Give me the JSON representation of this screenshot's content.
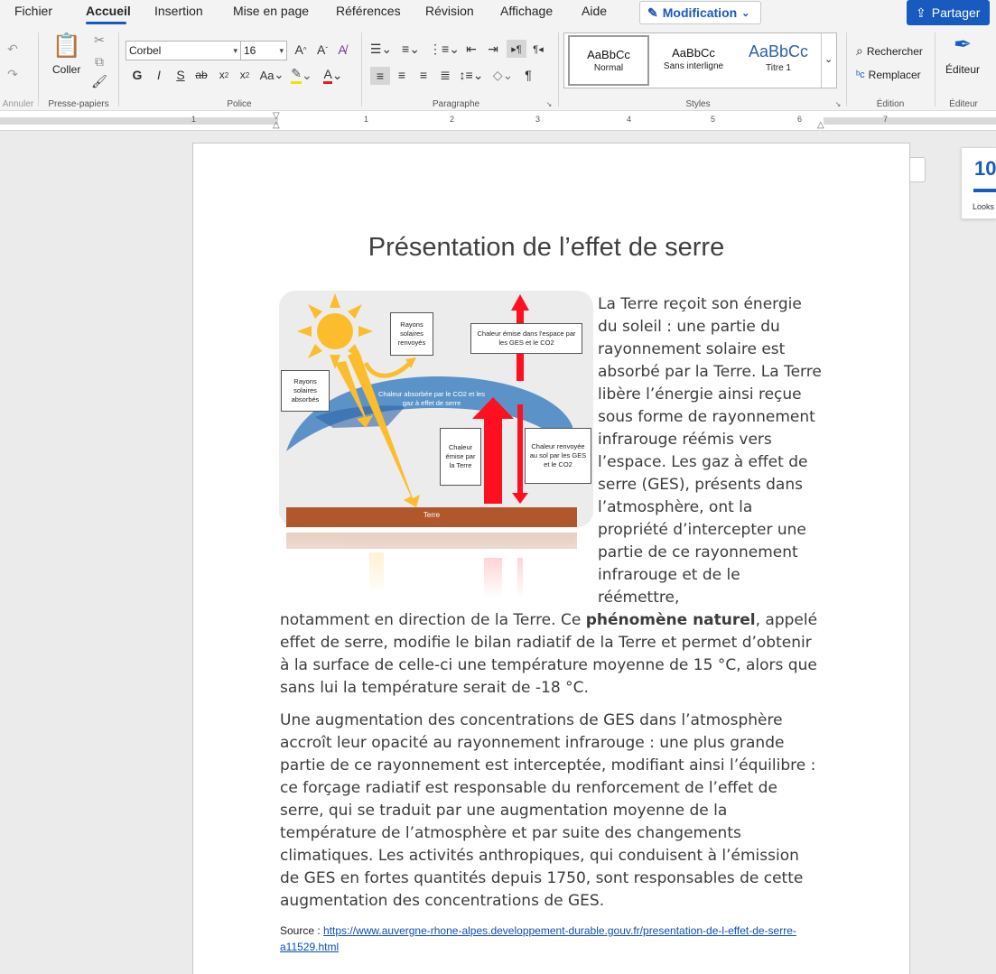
{
  "menu": {
    "items": [
      "Fichier",
      "Accueil",
      "Insertion",
      "Mise en page",
      "Références",
      "Révision",
      "Affichage",
      "Aide"
    ],
    "mode_label": "Modification",
    "share_label": "Partager"
  },
  "ribbon": {
    "undo_group": "Annuler",
    "clipboard": {
      "paste_label": "Coller",
      "group": "Presse-papiers"
    },
    "font": {
      "name": "Corbel",
      "size": "16",
      "group": "Police",
      "case_label": "Aa"
    },
    "paragraph": {
      "group": "Paragraphe"
    },
    "styles": {
      "group": "Styles",
      "items": [
        {
          "sample": "AaBbCc",
          "name": "Normal"
        },
        {
          "sample": "AaBbCc",
          "name": "Sans interligne"
        },
        {
          "sample": "AaBbCc",
          "name": "Titre 1"
        }
      ]
    },
    "edition": {
      "search": "Rechercher",
      "replace": "Remplacer",
      "group": "Édition"
    },
    "editor": {
      "label": "Éditeur",
      "group": "Éditeur"
    }
  },
  "ruler": {
    "numbers": [
      "1",
      "1",
      "2",
      "3",
      "4",
      "5",
      "6",
      "7"
    ]
  },
  "looks": {
    "count": "10",
    "label": "Looks"
  },
  "document": {
    "title": "Présentation de l’effet de serre",
    "p1_right": "La Terre reçoit son énergie du soleil : une partie du rayonnement solaire est absorbé par la Terre. La Terre libère l’énergie ainsi reçue sous forme de rayonnement infrarouge réémis vers l’espace. Les gaz à effet de serre (GES), présents dans l’atmosphère, ont la propriété d’intercepter une partie de ce rayonnement infrarouge et de le réémettre,",
    "p1_cont_before": "notamment en direction de la Terre. Ce ",
    "p1_bold": "phénomène naturel",
    "p1_cont_after": ", appelé effet de serre, modifie le bilan radiatif de la Terre et permet d’obtenir à la surface de celle-ci une température moyenne de 15 °C, alors que sans lui la température serait de -18 °C.",
    "p2": "Une augmentation des concentrations de GES dans l’atmosphère accroît leur opacité au rayonnement infrarouge : une plus grande partie de ce rayonnement est interceptée, modifiant ainsi l’équilibre : ce forçage radiatif est responsable du renforcement de l’effet de serre, qui se traduit par une augmentation moyenne de la température de l’atmosphère et par suite des changements climatiques. Les activités anthropiques, qui conduisent à l’émission de GES en fortes quantités depuis 1750, sont responsables de cette augmentation des concentrations de GES.",
    "source_label": "Source : ",
    "source_url": "https://www.auvergne-rhone-alpes.developpement-durable.gouv.fr/presentation-de-l-effet-de-serre-a11529.html"
  },
  "diagram": {
    "reflected_solar": "Rayons solaires renvoyés",
    "absorbed_solar": "Rayons solaires absorbés",
    "heat_space": "Chaleur émise dans l'espace par les GES et le CO2",
    "heat_absorbed": "Chaleur absorbée par le CO2 et les gaz à effet de serre",
    "heat_earth": "Chaleur émise par la Terre",
    "heat_returned": "Chaleur renvoyée au sol par les GES et le CO2",
    "ground": "Terre"
  },
  "colors": {
    "accent": "#185abd",
    "sun": "#fbbd2c",
    "arrow_red": "#ff1020",
    "atmosphere": "#5b93c9",
    "ground": "#b0582b",
    "link": "#0b4fb3"
  }
}
